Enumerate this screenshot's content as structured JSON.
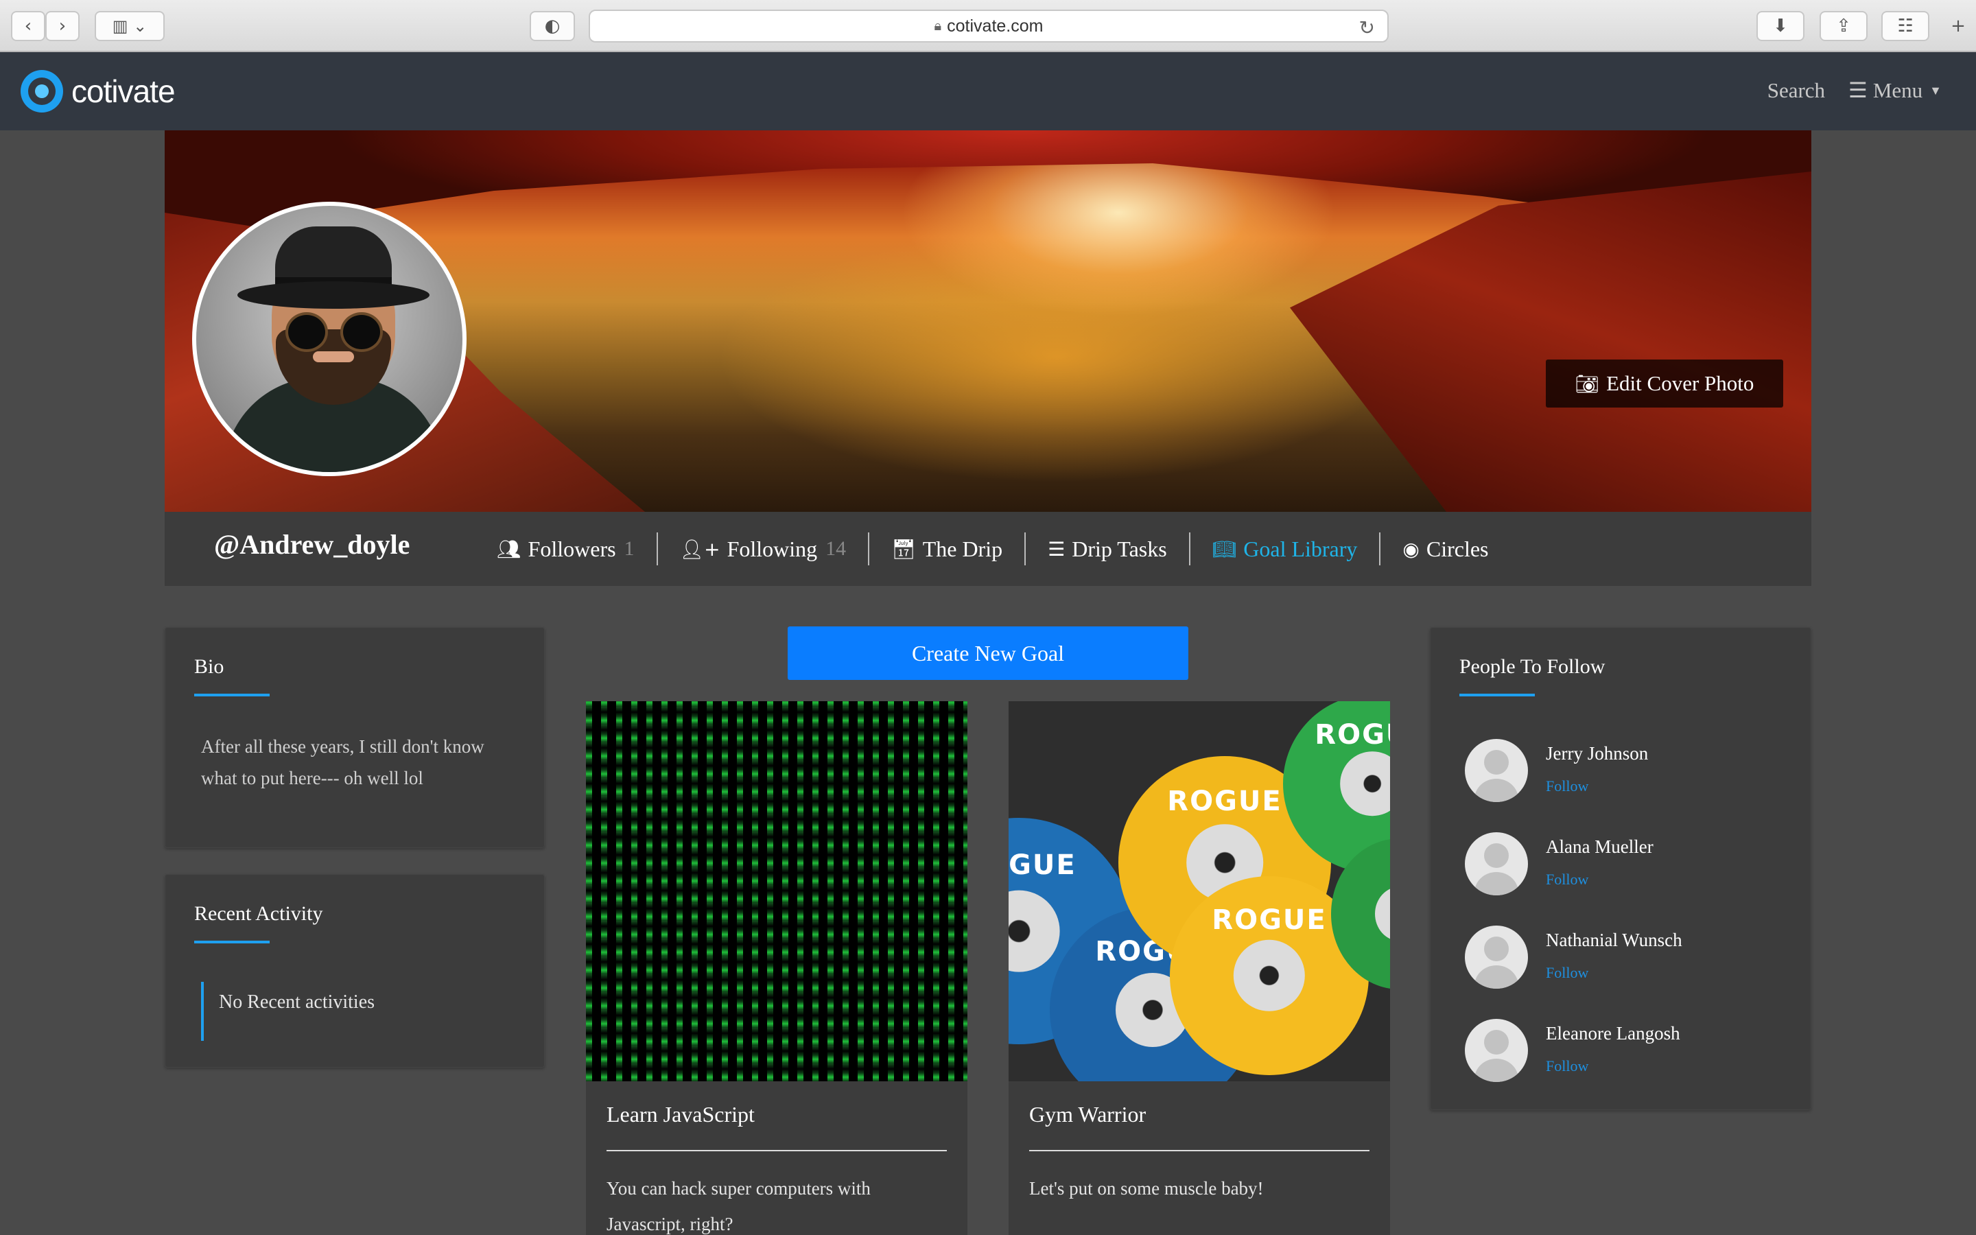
{
  "browser": {
    "url": "cotivate.com",
    "back_icon": "chevron-left-icon",
    "forward_icon": "chevron-right-icon"
  },
  "app": {
    "logo_text": "cotivate",
    "search_label": "Search",
    "menu_label": "Menu"
  },
  "profile": {
    "edit_cover_label": "Edit Cover Photo",
    "username": "@Andrew_doyle",
    "tabs": [
      {
        "label": "Followers",
        "count": "1",
        "icon": "users-icon"
      },
      {
        "label": "Following",
        "count": "14",
        "icon": "user-plus-icon"
      },
      {
        "label": "The Drip",
        "count": "",
        "icon": "calendar-check-icon"
      },
      {
        "label": "Drip Tasks",
        "count": "",
        "icon": "task-list-icon"
      },
      {
        "label": "Goal Library",
        "count": "",
        "icon": "book-reader-icon"
      },
      {
        "label": "Circles",
        "count": "",
        "icon": "user-circle-icon"
      }
    ]
  },
  "bio": {
    "title": "Bio",
    "text": "After all these years, I still don't know what to put here--- oh well lol"
  },
  "activity": {
    "title": "Recent Activity",
    "empty_text": "No Recent activities"
  },
  "goals": {
    "create_label": "Create New Goal",
    "items": [
      {
        "title": "Learn JavaScript",
        "description": "You can hack super computers with Javascript, right?"
      },
      {
        "title": "Gym Warrior",
        "description": "Let's put on some muscle baby!"
      }
    ],
    "plate_brand": "ROGUE"
  },
  "people": {
    "title": "People To Follow",
    "follow_label": "Follow",
    "items": [
      {
        "name": "Jerry Johnson"
      },
      {
        "name": "Alana Mueller"
      },
      {
        "name": "Nathanial Wunsch"
      },
      {
        "name": "Eleanore Langosh"
      }
    ]
  },
  "colors": {
    "accent": "#1ea0f0",
    "primary_button": "#0a7dff",
    "active_tab": "#1fb4e8",
    "nav_bg": "#323841",
    "page_bg": "#4a4a4a"
  }
}
